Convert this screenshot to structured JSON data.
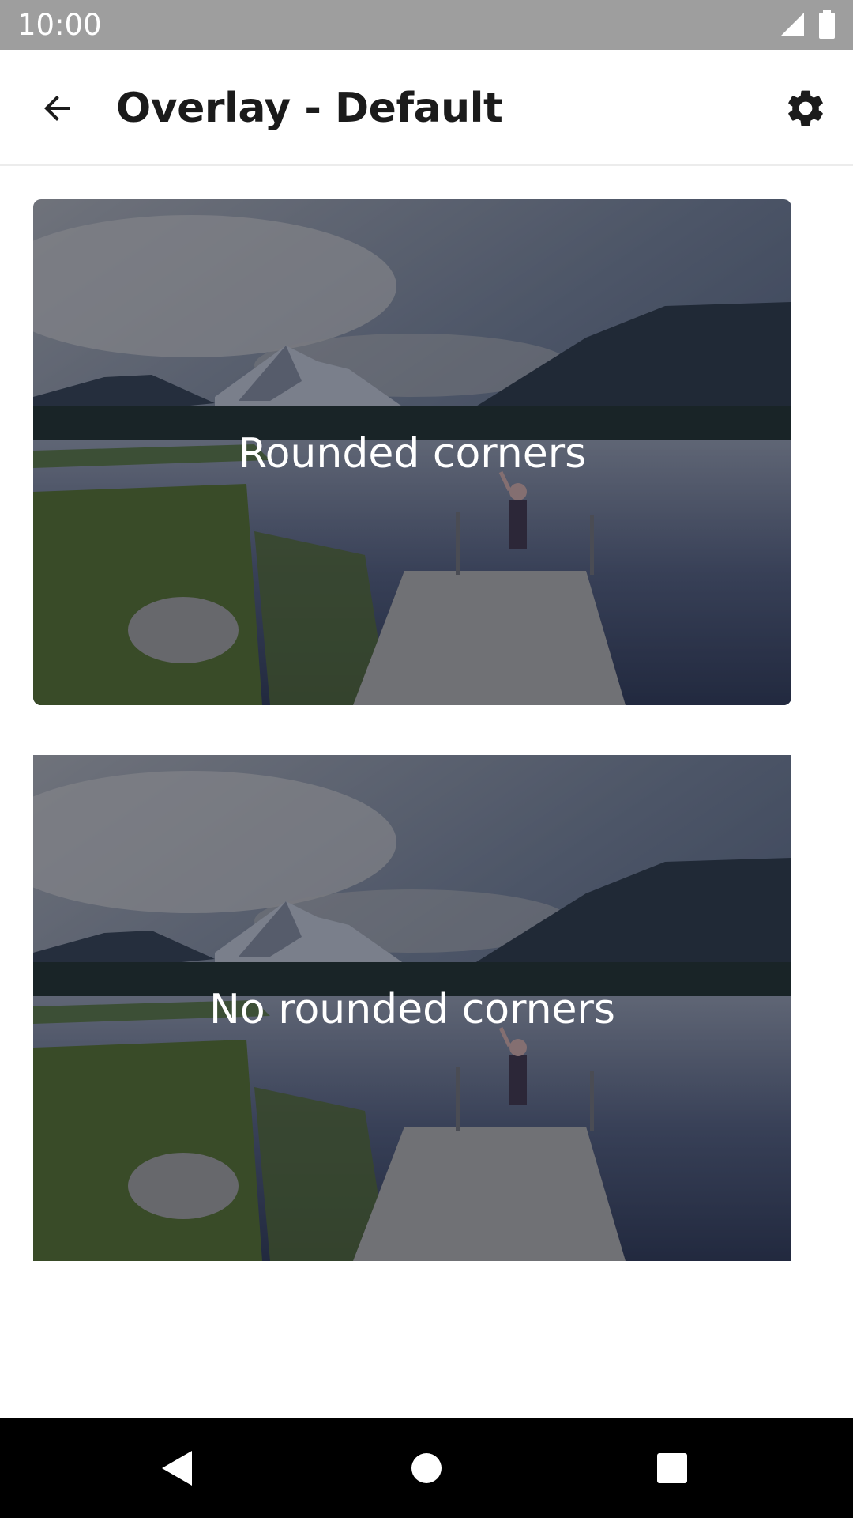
{
  "status_bar": {
    "time": "10:00",
    "icons": [
      "signal-icon",
      "battery-icon"
    ]
  },
  "app_bar": {
    "title": "Overlay - Default",
    "back_icon": "arrow-back-icon",
    "settings_icon": "gear-icon"
  },
  "cards": [
    {
      "label": "Rounded corners",
      "corners": "rounded"
    },
    {
      "label": "No rounded corners",
      "corners": "square"
    }
  ],
  "nav_bar": {
    "buttons": [
      "back-triangle-icon",
      "home-circle-icon",
      "recents-square-icon"
    ]
  },
  "colors": {
    "status_bar": "#9e9e9e",
    "overlay_tint": "#141a30",
    "nav_bar": "#000000"
  }
}
